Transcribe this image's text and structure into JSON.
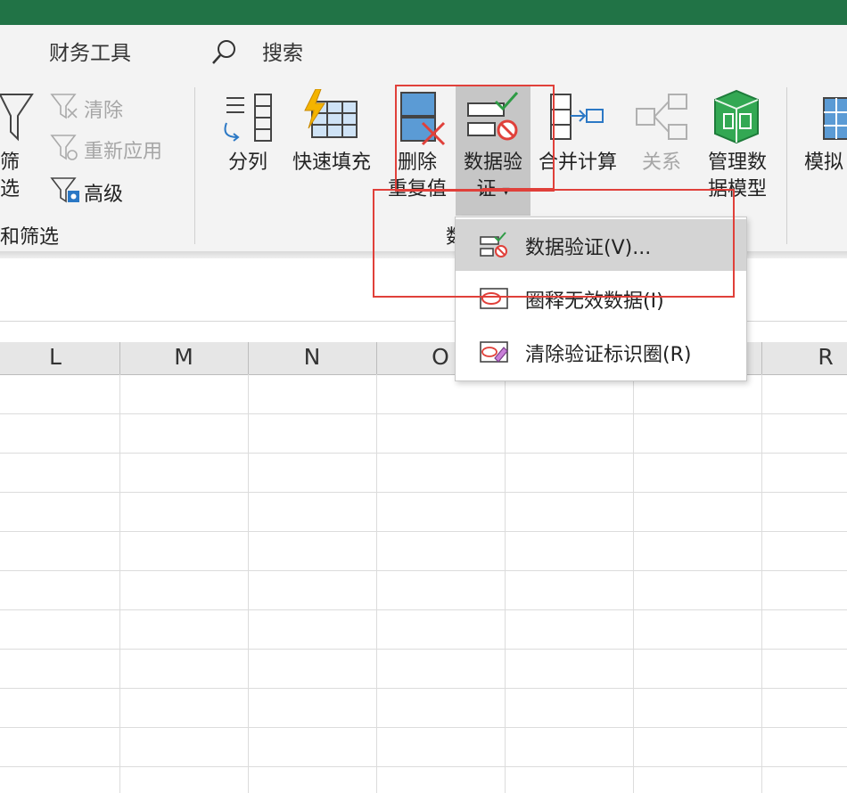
{
  "tabs": {
    "finance_tools": "财务工具",
    "search": "搜索"
  },
  "ribbon": {
    "filter_label": "筛选",
    "clear": "清除",
    "reapply": "重新应用",
    "advanced": "高级",
    "sort_filter_group": "和筛选",
    "text_to_columns": "分列",
    "flash_fill": "快速填充",
    "remove_dup_line1": "删除",
    "remove_dup_line2": "重复值",
    "data_validation_line1": "数据验",
    "data_validation_line2": "证",
    "dropdown_glyph": "▾",
    "consolidate": "合并计算",
    "relationships": "关系",
    "data_model_line1": "管理数",
    "data_model_line2": "据模型",
    "whatif_line1": "模拟",
    "data_tools_group": "数"
  },
  "menu": {
    "items": [
      {
        "label": "数据验证(V)..."
      },
      {
        "label": "圈释无效数据(I)"
      },
      {
        "label": "清除验证标识圈(R)"
      }
    ]
  },
  "columns": [
    "L",
    "M",
    "N",
    "O",
    "R"
  ],
  "colors": {
    "excel_green": "#217346",
    "highlight_red": "#e0403a",
    "menu_hover": "#d4d4d4"
  }
}
